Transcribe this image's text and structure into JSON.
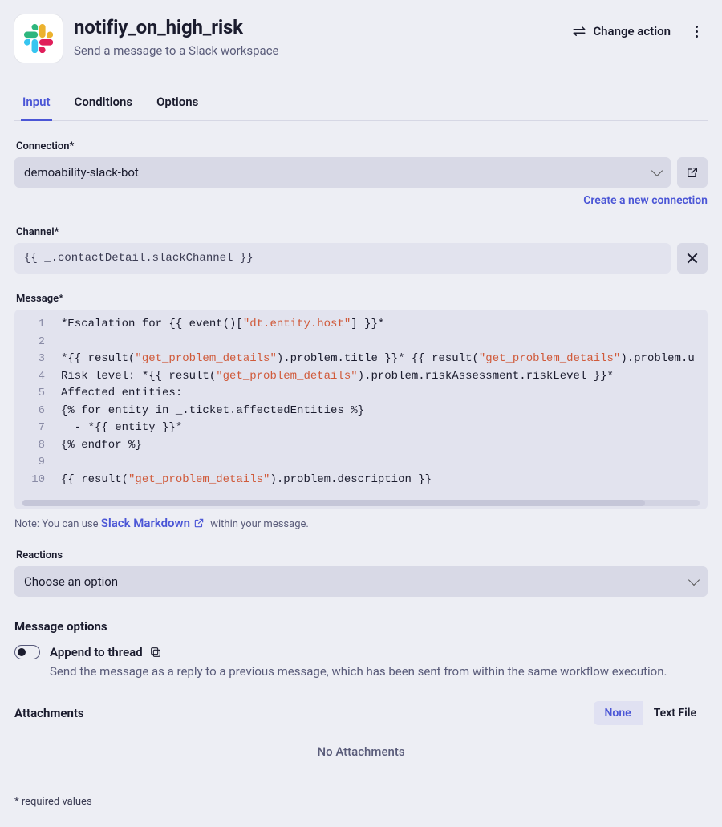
{
  "header": {
    "title": "notifiy_on_high_risk",
    "subtitle": "Send a message to a Slack workspace",
    "change_action": "Change action"
  },
  "tabs": [
    {
      "label": "Input",
      "active": true
    },
    {
      "label": "Conditions",
      "active": false
    },
    {
      "label": "Options",
      "active": false
    }
  ],
  "connection": {
    "label": "Connection*",
    "value": "demoability-slack-bot",
    "create_link": "Create a new connection"
  },
  "channel": {
    "label": "Channel*",
    "value": "{{ _.contactDetail.slackChannel }}"
  },
  "message": {
    "label": "Message*",
    "lines": [
      {
        "n": 1,
        "segments": [
          {
            "t": "*Escalation for {{ event()["
          },
          {
            "t": "\"dt.entity.host\"",
            "cls": "tok-str"
          },
          {
            "t": "] }}*"
          }
        ]
      },
      {
        "n": 2,
        "segments": [
          {
            "t": ""
          }
        ]
      },
      {
        "n": 3,
        "segments": [
          {
            "t": "*{{ result("
          },
          {
            "t": "\"get_problem_details\"",
            "cls": "tok-str"
          },
          {
            "t": ").problem.title }}* {{ result("
          },
          {
            "t": "\"get_problem_details\"",
            "cls": "tok-str"
          },
          {
            "t": ").problem.u"
          }
        ]
      },
      {
        "n": 4,
        "segments": [
          {
            "t": "Risk level: *{{ result("
          },
          {
            "t": "\"get_problem_details\"",
            "cls": "tok-str"
          },
          {
            "t": ").problem.riskAssessment.riskLevel }}*"
          }
        ]
      },
      {
        "n": 5,
        "segments": [
          {
            "t": "Affected entities:"
          }
        ]
      },
      {
        "n": 6,
        "segments": [
          {
            "t": "{% for entity in _.ticket.affectedEntities %}"
          }
        ]
      },
      {
        "n": 7,
        "segments": [
          {
            "t": "  - *{{ entity }}*"
          }
        ]
      },
      {
        "n": 8,
        "segments": [
          {
            "t": "{% endfor %}"
          }
        ]
      },
      {
        "n": 9,
        "segments": [
          {
            "t": ""
          }
        ]
      },
      {
        "n": 10,
        "segments": [
          {
            "t": "{{ result("
          },
          {
            "t": "\"get_problem_details\"",
            "cls": "tok-str"
          },
          {
            "t": ").problem.description }}"
          }
        ]
      }
    ],
    "note_prefix": "Note: You can use ",
    "note_link": "Slack Markdown",
    "note_suffix": " within your message."
  },
  "reactions": {
    "label": "Reactions",
    "placeholder": "Choose an option"
  },
  "message_options": {
    "heading": "Message options",
    "toggle_label": "Append to thread",
    "toggle_on": false,
    "desc": "Send the message as a reply to a previous message, which has been sent from within the same workflow execution."
  },
  "attachments": {
    "heading": "Attachments",
    "seg_none": "None",
    "seg_file": "Text File",
    "empty": "No Attachments"
  },
  "required_note": "* required values"
}
